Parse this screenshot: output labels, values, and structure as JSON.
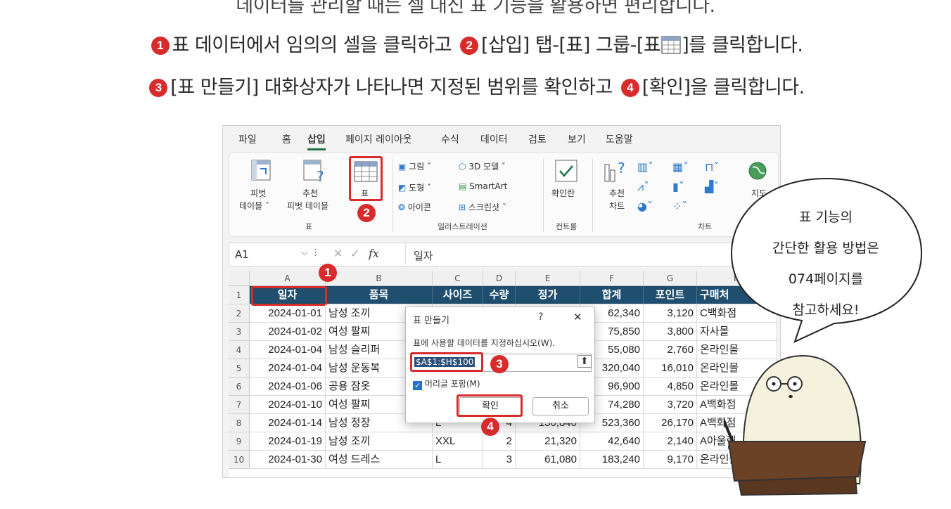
{
  "instructions": {
    "line0": "데이터를 관리할 때는 셀 대신 표 기능을 활용하면 편리합니다.",
    "line1_a": "표 데이터에서 임의의 셀을 클릭하고",
    "line1_b": "[삽입] 탭-[표] 그룹-[표",
    "line1_c": "]를 클릭합니다.",
    "line2_a": "[표 만들기] 대화상자가 나타나면 지정된 범위를 확인하고",
    "line2_b": "[확인]을 클릭합니다.",
    "step_numbers": [
      "1",
      "2",
      "3",
      "4"
    ]
  },
  "ribbon": {
    "tabs": [
      "파일",
      "홈",
      "삽입",
      "페이지 레이아웃",
      "수식",
      "데이터",
      "검토",
      "보기",
      "도움말"
    ],
    "active_tab": "삽입",
    "pivot_label1": "피벗",
    "pivot_label2": "테이블 ˇ",
    "rec_pivot_label1": "추천",
    "rec_pivot_label2": "피벗 테이블",
    "table_label": "표",
    "group_table": "표",
    "illus_picture": "그림 ˇ",
    "illus_shape": "도형 ˇ",
    "illus_icon": "아이콘",
    "illus_3d": "3D 모델  ˇ",
    "illus_smartart": "SmartArt",
    "illus_screenshot": "스크린샷 ˇ",
    "group_illus": "일러스트레이션",
    "checkbox_label": "확인란",
    "group_controls": "컨트롤",
    "rec_chart1": "추천",
    "rec_chart2": "차트",
    "group_charts": "차트",
    "map_label": "지도"
  },
  "formula_bar": {
    "name_box": "A1",
    "fx": "fx",
    "value": "일자"
  },
  "sheet": {
    "columns": [
      "A",
      "B",
      "C",
      "D",
      "E",
      "F",
      "G",
      "H"
    ],
    "header": [
      "일자",
      "품목",
      "사이즈",
      "수량",
      "정가",
      "합계",
      "포인트",
      "구매처"
    ],
    "rows": [
      {
        "num": "2",
        "cells": [
          "2024-01-01",
          "남성 조끼",
          "",
          "",
          "",
          "62,340",
          "3,120",
          "C백화점"
        ]
      },
      {
        "num": "3",
        "cells": [
          "2024-01-02",
          "여성 팔찌",
          "",
          "",
          "",
          "75,850",
          "3,800",
          "자사몰"
        ]
      },
      {
        "num": "4",
        "cells": [
          "2024-01-04",
          "남성 슬리퍼",
          "",
          "",
          "",
          "55,080",
          "2,760",
          "온라인몰"
        ]
      },
      {
        "num": "5",
        "cells": [
          "2024-01-04",
          "남성 운동복",
          "",
          "",
          "",
          "320,040",
          "16,010",
          "온라인몰"
        ]
      },
      {
        "num": "6",
        "cells": [
          "2024-01-06",
          "공용 잠옷",
          "",
          "",
          "",
          "96,900",
          "4,850",
          "온라인몰"
        ]
      },
      {
        "num": "7",
        "cells": [
          "2024-01-10",
          "여성 팔찌",
          "",
          "",
          "",
          "74,280",
          "3,720",
          "A백화점"
        ]
      },
      {
        "num": "8",
        "cells": [
          "2024-01-14",
          "남성 정장",
          "L",
          "4",
          "130,840",
          "523,360",
          "26,170",
          "A백화점"
        ]
      },
      {
        "num": "9",
        "cells": [
          "2024-01-19",
          "남성 조끼",
          "XXL",
          "2",
          "21,320",
          "42,640",
          "2,140",
          "A아울렛"
        ]
      },
      {
        "num": "10",
        "cells": [
          "2024-01-30",
          "여성 드레스",
          "L",
          "3",
          "61,080",
          "183,240",
          "9,170",
          "온라인몰"
        ]
      }
    ],
    "header_row_num": "1"
  },
  "dialog": {
    "title": "표 만들기",
    "help": "?",
    "close": "✕",
    "prompt": "표에 사용할 데이터를 지정하십시오(W).",
    "range": "$A$1:$H$100",
    "checkbox_label": "머리글 포함(M)",
    "ok": "확인",
    "cancel": "취소"
  },
  "bubble": {
    "l1": "표 기능의",
    "l2": "간단한 활용 방법은",
    "l3": "074페이지를",
    "l4": "참고하세요!"
  },
  "colors": {
    "accent": "#d82b2b",
    "excel_green": "#1e7145",
    "table_header": "#1f4e6e"
  }
}
